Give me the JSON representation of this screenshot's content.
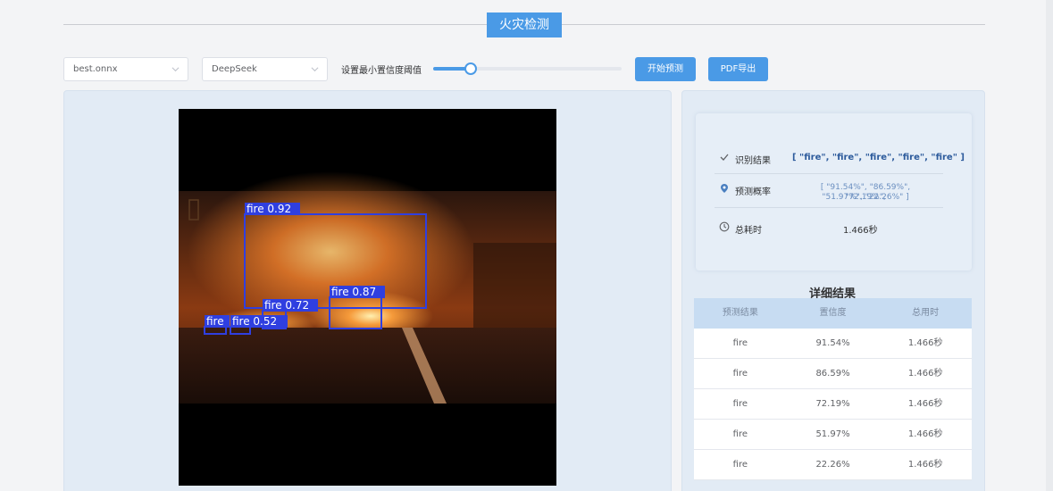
{
  "header": {
    "title": "火灾检测"
  },
  "toolbar": {
    "model_select": {
      "value": "best.onnx"
    },
    "llm_select": {
      "value": "DeepSeek"
    },
    "confidence_label": "设置最小置信度阈值",
    "confidence_value": 0.2,
    "predict_label": "开始预测",
    "export_label": "PDF导出"
  },
  "detections": [
    {
      "label": "fire 0.92"
    },
    {
      "label": "fire 0.87"
    },
    {
      "label": "fire 0.72"
    },
    {
      "label": "fire 0.52"
    },
    {
      "label": "fire"
    }
  ],
  "summary": {
    "result_label": "识别结果",
    "result_value": "[ \"fire\", \"fire\", \"fire\", \"fire\", \"fire\" ]",
    "prob_label": "预测概率",
    "prob_value_line1": "[ \"91.54%\", \"86.59%\", \"72.19%\",",
    "prob_value_line2": "\"51.97%\", \"22.26%\" ]",
    "time_label": "总耗时",
    "time_value": "1.466秒"
  },
  "details": {
    "title": "详细结果",
    "columns": [
      "预测结果",
      "置信度",
      "总用时"
    ],
    "rows": [
      [
        "fire",
        "91.54%",
        "1.466秒"
      ],
      [
        "fire",
        "86.59%",
        "1.466秒"
      ],
      [
        "fire",
        "72.19%",
        "1.466秒"
      ],
      [
        "fire",
        "51.97%",
        "1.466秒"
      ],
      [
        "fire",
        "22.26%",
        "1.466秒"
      ]
    ]
  },
  "colors": {
    "accent": "#4a9ae6",
    "detection_box": "#2f3fe0"
  }
}
